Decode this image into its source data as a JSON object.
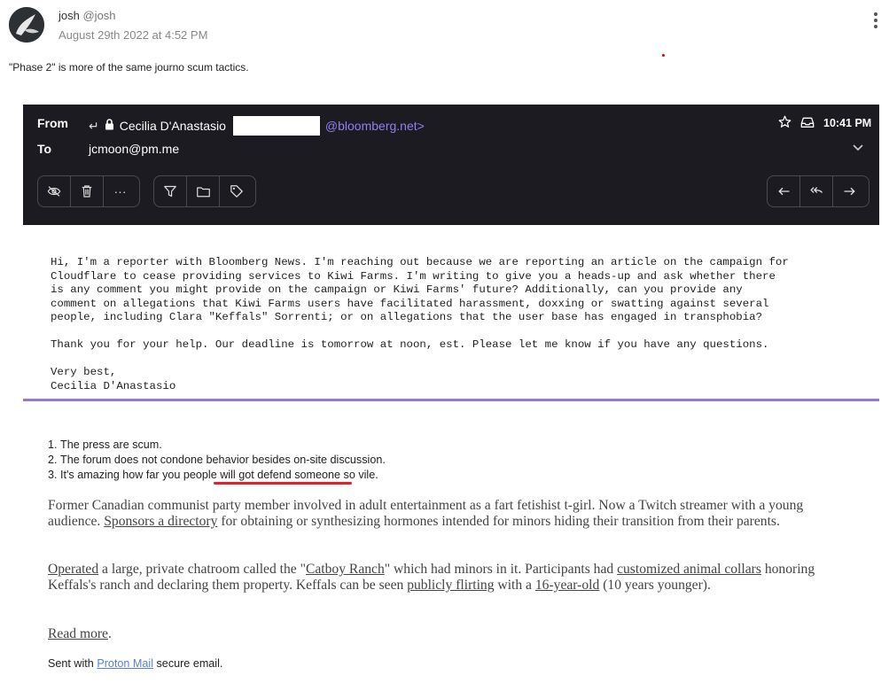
{
  "post": {
    "author_name": "josh",
    "author_handle": "@josh",
    "date": "August 29th 2022 at 4:52 PM",
    "text": "\"Phase 2\" is more of the same journo scum tactics."
  },
  "email": {
    "from_label": "From",
    "to_label": "To",
    "from_name": "Cecilia D'Anastasio",
    "from_domain": "@bloomberg.net>",
    "to_address": "jcmoon@pm.me",
    "time": "10:41 PM",
    "body_lines": [
      "Hi, I'm a reporter with Bloomberg News. I'm reaching out because we are reporting an article on the campaign for",
      "Cloudflare to cease providing services to Kiwi Farms. I'm writing to give you a heads-up and ask whether there",
      "is any comment you might provide on the campaign or Kiwi Farms' future? Additionally, can you provide any",
      "comment on allegations that Kiwi Farms users have facilitated harassment, doxxing or swatting against several",
      "people, including Clara \"Keffals\" Sorrenti; or on allegations that the user base has engaged in transphobia?",
      "",
      "Thank you for your help. Our deadline is tomorrow at noon, est. Please let me know if you have any questions.",
      "",
      "Very best,",
      "Cecilia D'Anastasio"
    ],
    "list_items": [
      "The press are scum.",
      "The forum does not condone behavior besides on-site discussion.",
      "It's amazing how far you people will got defend someone so vile."
    ],
    "p1": {
      "t1": "Former Canadian communist party member involved in adult entertainment as a fart fetishist t-girl. Now a Twitch streamer with a young audience. ",
      "link1": "Sponsors a directory",
      "t2": " for obtaining or synthesizing hormones intended for minors hiding their transition from their parents."
    },
    "p2": {
      "link1": "Operated",
      "t1": " a large, private chatroom called the \"",
      "link2": "Catboy Ranch",
      "t2": "\" which had minors in it. Participants had ",
      "link3": "customized animal collars",
      "t3": " honoring Keffals's ranch and declaring them property. Keffals can be seen ",
      "link4": "publicly flirting",
      "t4": " with a ",
      "link5": "16-year-old",
      "t5": " (10 years younger)."
    },
    "p3": {
      "link": "Read more",
      "t": "."
    },
    "signature": {
      "before": "Sent with ",
      "link": "Proton Mail",
      "after": " secure email."
    }
  },
  "colors": {
    "mail_header_bg": "#1c1b22",
    "domain_purple": "#8f7ff0",
    "divider_purple": "#9b79c9",
    "annotation_red": "#e0222a",
    "link_blue": "#5a7fd6"
  },
  "icons": [
    "reply-icon",
    "lock-icon",
    "star-icon",
    "inbox-icon",
    "eye-slash-icon",
    "trash-icon",
    "more-icon",
    "filter-icon",
    "folder-icon",
    "tag-icon",
    "reply-all-icon",
    "forward-icon",
    "chevron-down-icon",
    "kebab-menu-icon"
  ]
}
